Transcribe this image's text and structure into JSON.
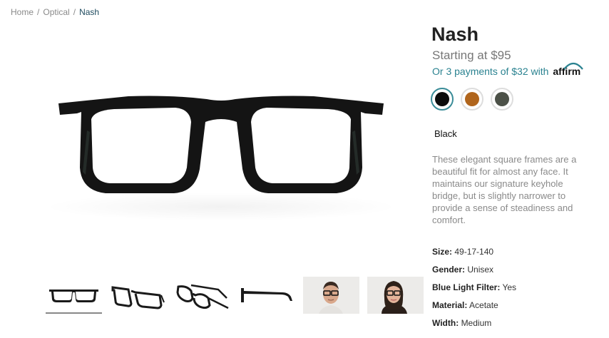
{
  "breadcrumb": {
    "home": "Home",
    "sep": "/",
    "category": "Optical",
    "current": "Nash"
  },
  "product": {
    "name": "Nash",
    "price": "Starting at $95",
    "payments": "Or 3 payments of $32 with",
    "affirm": "affirm",
    "selected_color": "Black",
    "description": "These elegant square frames are a beautiful fit for almost any face. It maintains our signature keyhole bridge, but is slightly narrower to provide a sense of steadiness and comfort."
  },
  "swatches": [
    {
      "name": "black",
      "color": "#0c0c0c"
    },
    {
      "name": "tortoise",
      "color": "#b0651c"
    },
    {
      "name": "grey",
      "color": "#4c5148"
    }
  ],
  "specs": [
    {
      "label": "Size:",
      "value": "49-17-140"
    },
    {
      "label": "Gender:",
      "value": "Unisex"
    },
    {
      "label": "Blue Light Filter:",
      "value": "Yes"
    },
    {
      "label": "Material:",
      "value": "Acetate"
    },
    {
      "label": "Width:",
      "value": "Medium"
    }
  ],
  "thumbnails": [
    "front-view-icon",
    "angle-view-icon",
    "side-angle-view-icon",
    "side-view-icon",
    "man-model-icon",
    "woman-model-icon"
  ]
}
